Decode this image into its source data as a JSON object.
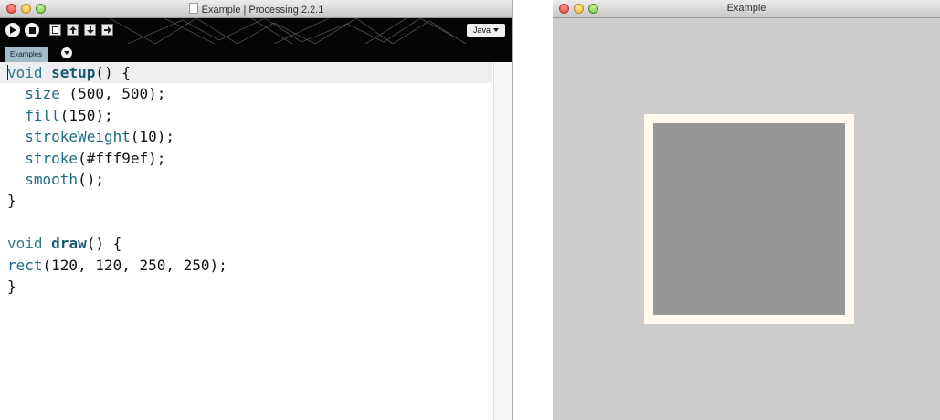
{
  "ide": {
    "title": "Example  | Processing 2.2.1",
    "mode_label": "Java",
    "tab_label": "Examples",
    "code": {
      "l1_kw": "void ",
      "l1_fn": "setup",
      "l1_rest": "() {",
      "l2_api": "size",
      "l2_rest": " (500, 500);",
      "l3_api": "fill",
      "l3_rest": "(150);",
      "l4_api": "strokeWeight",
      "l4_rest": "(10);",
      "l5_api": "stroke",
      "l5_rest": "(#fff9ef);",
      "l6_api": "smooth",
      "l6_rest": "();",
      "l7": "}",
      "l9_kw": "void ",
      "l9_fn": "draw",
      "l9_rest": "() {",
      "l10_api": "rect",
      "l10_rest": "(120, 120, 250, 250);",
      "l11": "}"
    }
  },
  "sketch": {
    "title": "Example",
    "background": "#cccccc",
    "rect_fill": "#969696",
    "rect_stroke": "#fff9ef"
  },
  "icons": [
    "run-icon",
    "stop-icon",
    "new-icon",
    "open-icon",
    "save-icon",
    "export-icon",
    "chevron-down-icon"
  ]
}
